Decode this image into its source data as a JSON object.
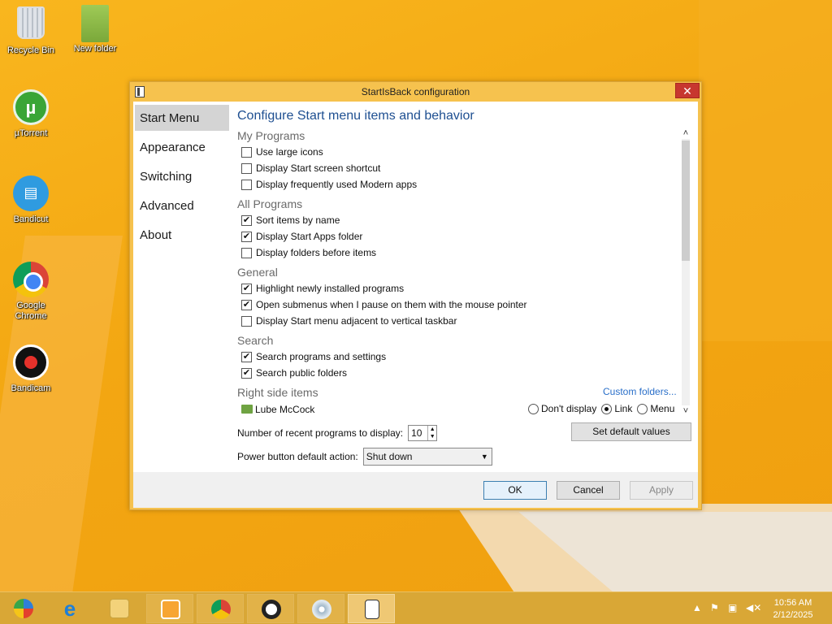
{
  "desktop": {
    "icons": [
      {
        "label": "Recycle Bin"
      },
      {
        "label": "New folder"
      },
      {
        "label": "µTorrent"
      },
      {
        "label": "Bandicut"
      },
      {
        "label": "Google Chrome"
      },
      {
        "label": "Bandicam"
      }
    ]
  },
  "window": {
    "title": "StartIsBack configuration",
    "close_glyph": "✕",
    "nav": [
      "Start Menu",
      "Appearance",
      "Switching",
      "Advanced",
      "About"
    ],
    "active_nav": "Start Menu",
    "heading": "Configure Start menu items and behavior",
    "sections": {
      "my_programs": {
        "title": "My Programs",
        "options": [
          {
            "label": "Use large icons",
            "checked": false
          },
          {
            "label": "Display Start screen shortcut",
            "checked": false
          },
          {
            "label": "Display frequently used Modern apps",
            "checked": false
          }
        ]
      },
      "all_programs": {
        "title": "All Programs",
        "options": [
          {
            "label": "Sort items by name",
            "checked": true
          },
          {
            "label": "Display Start Apps folder",
            "checked": true
          },
          {
            "label": "Display folders before items",
            "checked": false
          }
        ]
      },
      "general": {
        "title": "General",
        "options": [
          {
            "label": "Highlight newly installed programs",
            "checked": true
          },
          {
            "label": "Open submenus when I pause on them with the mouse pointer",
            "checked": true
          },
          {
            "label": "Display Start menu adjacent to vertical taskbar",
            "checked": false
          }
        ]
      },
      "search": {
        "title": "Search",
        "options": [
          {
            "label": "Search programs and settings",
            "checked": true
          },
          {
            "label": "Search public folders",
            "checked": true
          }
        ]
      },
      "right_side": {
        "title": "Right side items",
        "custom_link": "Custom folders...",
        "item": "Lube McCock",
        "radios": [
          {
            "label": "Don't display",
            "selected": false
          },
          {
            "label": "Link",
            "selected": true
          },
          {
            "label": "Menu",
            "selected": false
          }
        ]
      }
    },
    "recent": {
      "label": "Number of recent programs to display:",
      "value": "10"
    },
    "power": {
      "label": "Power button default action:",
      "value": "Shut down"
    },
    "buttons": {
      "set_default": "Set default values",
      "ok": "OK",
      "cancel": "Cancel",
      "apply": "Apply"
    }
  },
  "taskbar": {
    "clock_time": "10:56 AM",
    "clock_date": "2/12/2025"
  },
  "colors": {
    "accent": "#1e4f91",
    "window_frame": "#f6c24e",
    "desktop": "#f3a712",
    "close": "#c7372f",
    "link": "#2a6fc9"
  }
}
